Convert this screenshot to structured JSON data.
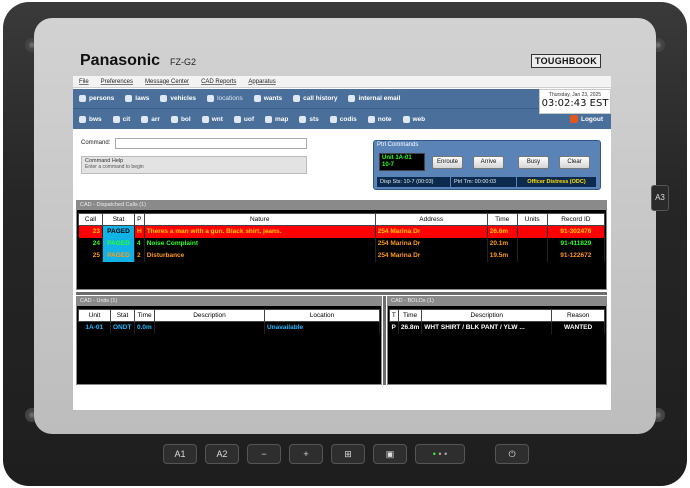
{
  "device": {
    "brand": "Panasonic",
    "model": "FZ-G2",
    "series": "TOUGHBOOK",
    "side_button": "A3",
    "hw_buttons": [
      "A1",
      "A2",
      "−",
      "+"
    ]
  },
  "menu": [
    "File",
    "Preferences",
    "Message Center",
    "CAD Reports",
    "Apparatus"
  ],
  "nav_row1": [
    "persons",
    "laws",
    "vehicles",
    "locations",
    "wants",
    "call history",
    "internal email"
  ],
  "nav_row2": [
    "bws",
    "cit",
    "arr",
    "bol",
    "wnt",
    "uof",
    "map",
    "sts",
    "codis",
    "note",
    "web"
  ],
  "logout_label": "Logout",
  "clock": {
    "date": "Thursday, Jan 23, 2025",
    "time": "03:02:43 EST"
  },
  "command": {
    "label": "Command:",
    "value": "",
    "help_title": "Command Help",
    "help_text": "Enter a command to begin"
  },
  "ptrl": {
    "title": "Ptrl Commands",
    "unit_line1": "Unit 1A-01",
    "unit_line2": "10-7",
    "buttons": [
      "Enroute",
      "Arrive",
      "Busy",
      "Clear"
    ],
    "disp_sts": "Disp Sts: 10-7 (00:03)",
    "ptrl_tm": "Ptrl Tm: 00:00:03",
    "alert": "Officer Distress (ODC)"
  },
  "dispatched": {
    "title": "CAD - Dispatched Calls (1)",
    "headers": [
      "Call",
      "Stat",
      "P",
      "Nature",
      "Address",
      "Time",
      "Units",
      "Record ID"
    ],
    "rows": [
      {
        "call": "23",
        "stat": "PAGED",
        "p": "H",
        "nature": "Theres a man with a gun. Black shirt, jeans.",
        "address": "254 Marina Dr",
        "time": "26.6m",
        "units": "",
        "record": "91-302476"
      },
      {
        "call": "24",
        "stat": "PAGED",
        "p": "4",
        "nature": "Noise Complaint",
        "address": "254 Marina Dr",
        "time": "20.1m",
        "units": "",
        "record": "91-411829"
      },
      {
        "call": "25",
        "stat": "PAGED",
        "p": "2",
        "nature": "Disturbance",
        "address": "254 Marina Dr",
        "time": "19.5m",
        "units": "",
        "record": "91-122672"
      }
    ]
  },
  "units": {
    "title": "CAD - Units (1)",
    "headers": [
      "Unit",
      "Stat",
      "Time",
      "Description",
      "Location"
    ],
    "rows": [
      {
        "unit": "1A-01",
        "stat": "ONDT",
        "time": "0.0m",
        "desc": "",
        "loc": "Unavailable"
      }
    ]
  },
  "bolos": {
    "title": "CAD - BOLOs (1)",
    "headers": [
      "T",
      "Time",
      "Description",
      "Reason"
    ],
    "rows": [
      {
        "t": "P",
        "time": "26.8m",
        "desc": "WHT SHIRT / BLK PANT / YLW ...",
        "reason": "WANTED"
      }
    ]
  }
}
